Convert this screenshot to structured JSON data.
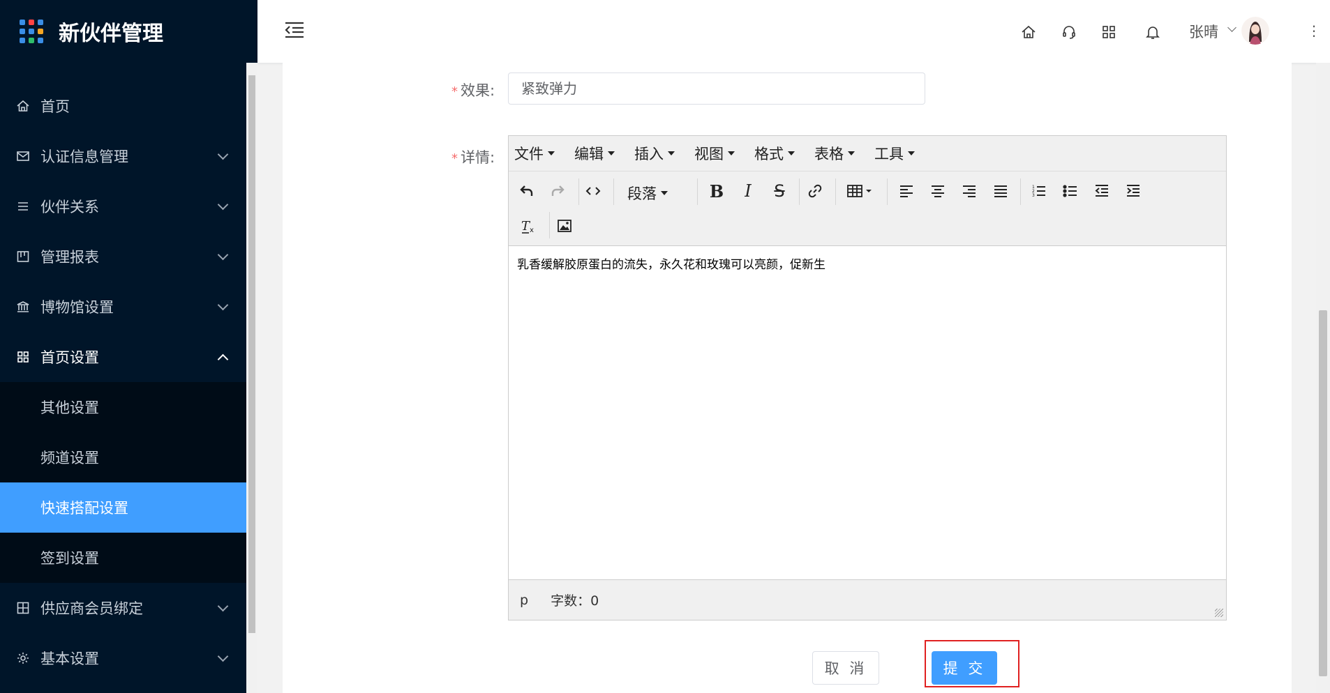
{
  "app": {
    "title": "新伙伴管理"
  },
  "sidebar": {
    "items": [
      {
        "label": "首页",
        "icon": "home-icon"
      },
      {
        "label": "认证信息管理",
        "icon": "mail-icon"
      },
      {
        "label": "伙伴关系",
        "icon": "list-icon"
      },
      {
        "label": "管理报表",
        "icon": "board-icon"
      },
      {
        "label": "博物馆设置",
        "icon": "bank-icon"
      },
      {
        "label": "首页设置",
        "icon": "grid-icon"
      },
      {
        "label": "供应商会员绑定",
        "icon": "apps-icon"
      },
      {
        "label": "基本设置",
        "icon": "gear-icon"
      }
    ],
    "submenu": [
      {
        "label": "其他设置"
      },
      {
        "label": "频道设置"
      },
      {
        "label": "快速搭配设置"
      },
      {
        "label": "签到设置"
      }
    ]
  },
  "header": {
    "username": "张晴"
  },
  "form": {
    "effect_label": "效果",
    "effect_value": "紧致弹力",
    "details_label": "详情",
    "required_mark": "*"
  },
  "editor": {
    "menus": [
      "文件",
      "编辑",
      "插入",
      "视图",
      "格式",
      "表格",
      "工具"
    ],
    "paragraph_select": "段落",
    "content": "乳香缓解胶原蛋白的流失，永久花和玫瑰可以亮颜，促新生",
    "status_path": "p",
    "word_count": "字数：0"
  },
  "buttons": {
    "cancel": "取 消",
    "submit": "提 交"
  },
  "colors": {
    "sidebar_bg": "#001529",
    "primary": "#409eff",
    "required": "#f56c6c",
    "highlight": "#e02020"
  }
}
